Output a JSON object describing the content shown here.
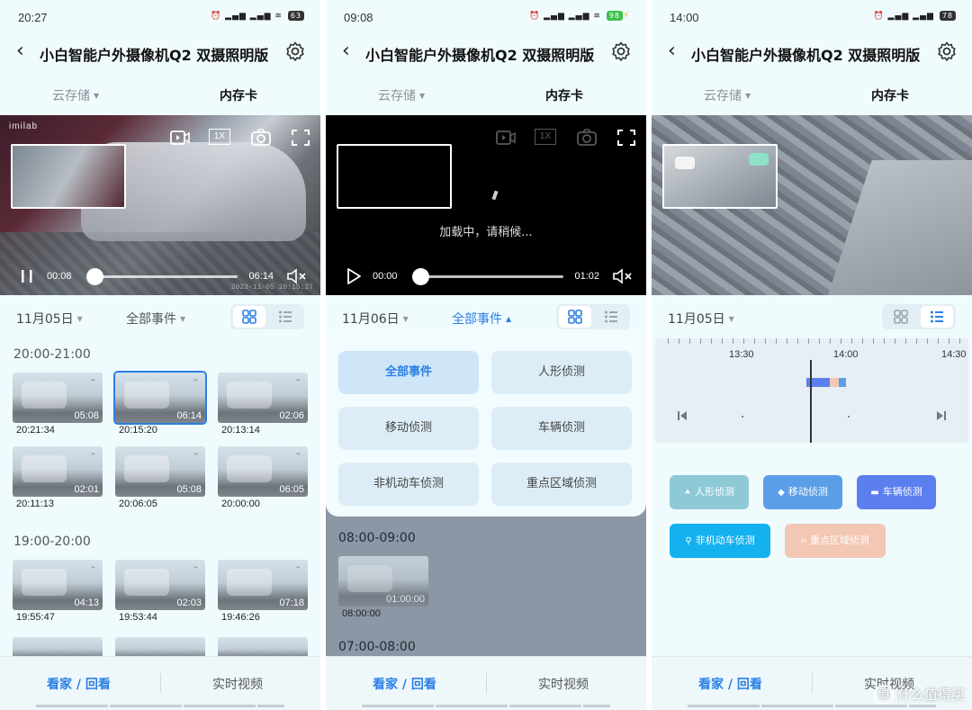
{
  "common": {
    "title": "小白智能户外摄像机Q2 双摄照明版",
    "tab_cloud": "云存储",
    "tab_card": "内存卡",
    "filter_all_events": "全部事件",
    "nav_home": "看家 / 回看",
    "nav_live": "实时视频",
    "speed": "1X"
  },
  "phone1": {
    "status_time": "20:27",
    "battery": "63",
    "brand": "imilab",
    "current_time": "00:08",
    "duration": "06:14",
    "progress": 0.0,
    "osd_stamp": "2023-11-05  20:15:27",
    "date": "11月05日",
    "sections": [
      {
        "label": "20:00-21:00",
        "items": [
          {
            "dur": "05:08",
            "time": "20:21:34",
            "selected": false
          },
          {
            "dur": "06:14",
            "time": "20:15:20",
            "selected": true
          },
          {
            "dur": "02:06",
            "time": "20:13:14",
            "selected": false
          },
          {
            "dur": "02:01",
            "time": "20:11:13",
            "selected": false
          },
          {
            "dur": "05:08",
            "time": "20:06:05",
            "selected": false
          },
          {
            "dur": "06:05",
            "time": "20:00:00",
            "selected": false
          }
        ]
      },
      {
        "label": "19:00-20:00",
        "items": [
          {
            "dur": "04:13",
            "time": "19:55:47",
            "selected": false
          },
          {
            "dur": "02:03",
            "time": "19:53:44",
            "selected": false
          },
          {
            "dur": "07:18",
            "time": "19:46:26",
            "selected": false
          }
        ]
      }
    ]
  },
  "phone2": {
    "status_time": "09:08",
    "battery": "98",
    "loading_text": "加载中，请稍候...",
    "current_time": "00:00",
    "duration": "01:02",
    "date": "11月06日",
    "event_options": [
      {
        "label": "全部事件",
        "selected": true
      },
      {
        "label": "人形侦测",
        "selected": false
      },
      {
        "label": "移动侦测",
        "selected": false
      },
      {
        "label": "车辆侦测",
        "selected": false
      },
      {
        "label": "非机动车侦测",
        "selected": false
      },
      {
        "label": "重点区域侦测",
        "selected": false
      }
    ],
    "sections": [
      {
        "label": "08:00-09:00",
        "items": [
          {
            "dur": "01:00:00",
            "time": "08:00:00"
          }
        ]
      },
      {
        "label": "07:00-08:00",
        "items": []
      }
    ]
  },
  "phone3": {
    "status_time": "14:00",
    "battery": "78",
    "date": "11月05日",
    "timeline_labels": [
      "13:30",
      "14:00",
      "14:30"
    ],
    "event_chips": [
      {
        "label": "人形侦测",
        "icon": "person-icon",
        "color": "#8ec9d6"
      },
      {
        "label": "移动侦测",
        "icon": "motion-icon",
        "color": "#5b9ee8"
      },
      {
        "label": "车辆侦测",
        "icon": "car-icon",
        "color": "#5c7ff0"
      },
      {
        "label": "非机动车侦测",
        "icon": "bike-icon",
        "color": "#13b1ef"
      },
      {
        "label": "重点区域侦测",
        "icon": "region-icon",
        "color": "#f2c7b4"
      }
    ],
    "watermark": "什么值得买"
  },
  "colors": {
    "accent": "#2b7fe4",
    "background": "#f0fbfd"
  }
}
